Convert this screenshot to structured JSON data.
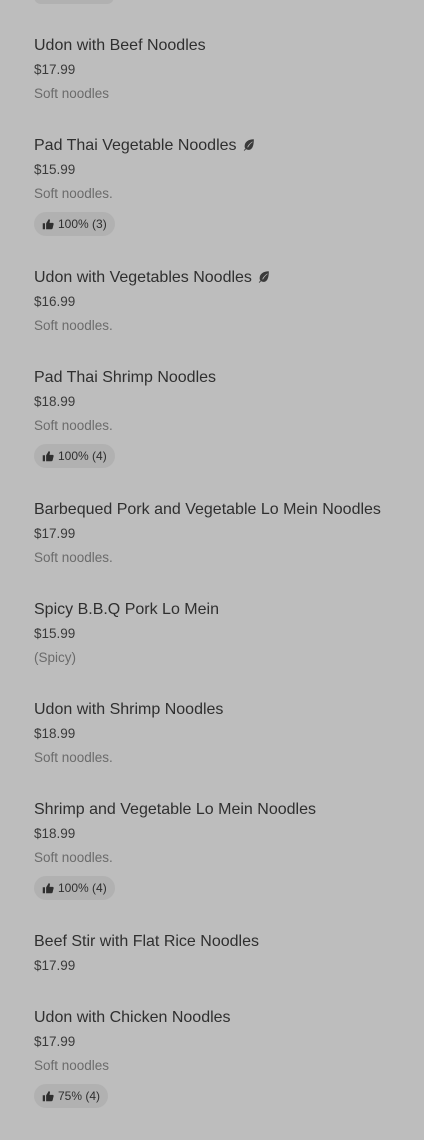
{
  "menu": {
    "items": [
      {
        "name": "Udon with Beef Noodles",
        "price": "$17.99",
        "description": "Soft noodles"
      },
      {
        "name": "Pad Thai Vegetable Noodles",
        "price": "$15.99",
        "description": "Soft noodles.",
        "rating": "100% (3)",
        "icon": "leaf-icon"
      },
      {
        "name": "Udon with Vegetables Noodles",
        "price": "$16.99",
        "description": "Soft noodles.",
        "icon": "leaf-icon"
      },
      {
        "name": "Pad Thai Shrimp Noodles",
        "price": "$18.99",
        "description": "Soft noodles.",
        "rating": "100% (4)"
      },
      {
        "name": "Barbequed Pork and Vegetable Lo Mein Noodles",
        "price": "$17.99",
        "description": "Soft noodles."
      },
      {
        "name": "Spicy B.B.Q Pork Lo Mein",
        "price": "$15.99",
        "description": "(Spicy)"
      },
      {
        "name": "Udon with Shrimp Noodles",
        "price": "$18.99",
        "description": "Soft noodles."
      },
      {
        "name": "Shrimp and Vegetable Lo Mein Noodles",
        "price": "$18.99",
        "description": "Soft noodles.",
        "rating": "100% (4)"
      },
      {
        "name": "Beef Stir with Flat Rice Noodles",
        "price": "$17.99"
      },
      {
        "name": "Udon with Chicken Noodles",
        "price": "$17.99",
        "description": "Soft noodles",
        "rating": "75% (4)"
      }
    ]
  }
}
